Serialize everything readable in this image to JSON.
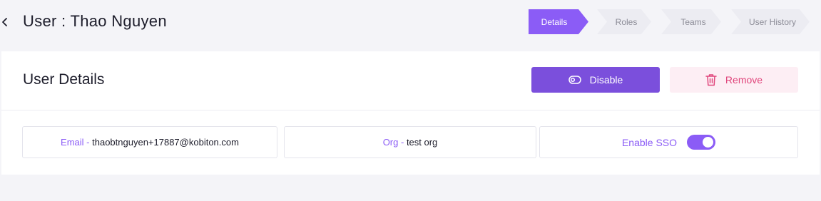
{
  "header": {
    "title": "User : Thao Nguyen"
  },
  "steps": [
    {
      "label": "Details",
      "active": true
    },
    {
      "label": "Roles",
      "active": false
    },
    {
      "label": "Teams",
      "active": false
    },
    {
      "label": "User History",
      "active": false
    }
  ],
  "card": {
    "title": "User Details",
    "disable_label": "Disable",
    "remove_label": "Remove"
  },
  "fields": {
    "email_label": "Email - ",
    "email_value": "thaobtnguyen+17887@kobiton.com",
    "org_label": "Org - ",
    "org_value": "test org",
    "sso_label": "Enable SSO",
    "sso_enabled": true
  },
  "colors": {
    "accent": "#8b5cf6",
    "button_primary": "#7b4fdc",
    "danger": "#e0457b",
    "danger_bg": "#fdeef4"
  },
  "icons": {
    "back": "chevron-left-icon",
    "disable": "toggle-off-icon",
    "remove": "trash-icon"
  }
}
